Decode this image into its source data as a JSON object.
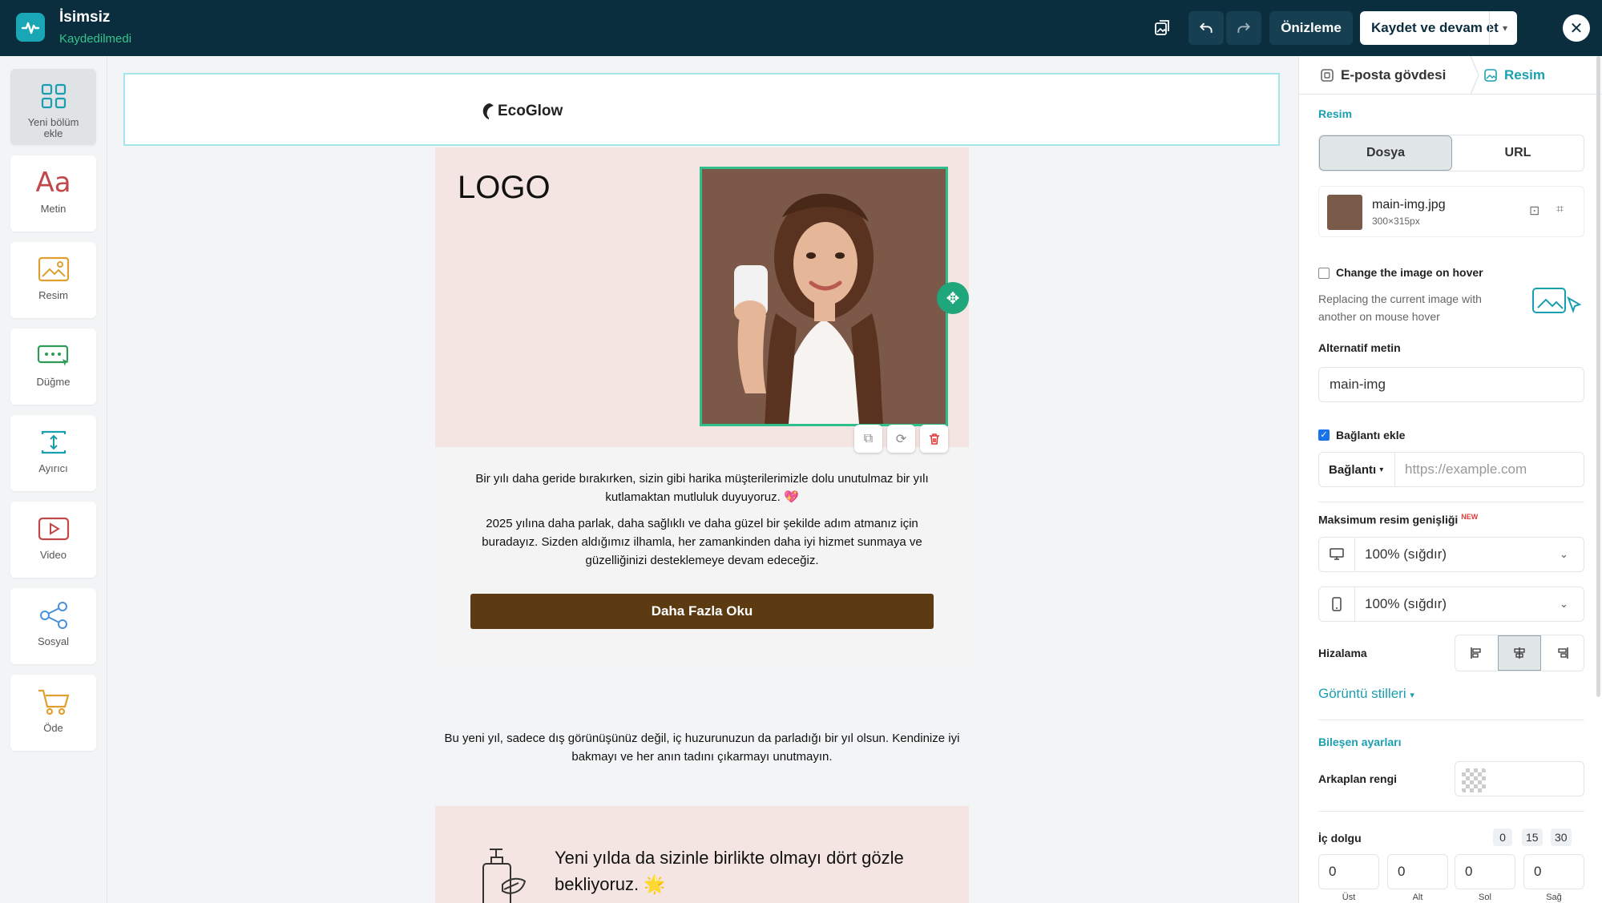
{
  "app": {
    "title": "İsimsiz",
    "status": "Kaydedilmedi",
    "preview_label": "Önizleme",
    "save_label": "Kaydet ve devam et",
    "close_glyph": "✕",
    "accent": "#19a7b5",
    "topbar_color": "#0b2e3f"
  },
  "sidebar": {
    "items": [
      {
        "label": "Yeni bölüm ekle",
        "icon": "grid-icon"
      },
      {
        "label": "Metin",
        "icon": "text-icon"
      },
      {
        "label": "Resim",
        "icon": "image-icon"
      },
      {
        "label": "Düğme",
        "icon": "button-icon"
      },
      {
        "label": "Ayırıcı",
        "icon": "divider-icon"
      },
      {
        "label": "Video",
        "icon": "video-icon"
      },
      {
        "label": "Sosyal",
        "icon": "share-icon"
      },
      {
        "label": "Öde",
        "icon": "cart-icon"
      }
    ]
  },
  "email": {
    "brand": "EcoGlow",
    "logo_placeholder": "LOGO",
    "paragraph1": "Bir yılı daha geride bırakırken, sizin gibi harika müşterilerimizle dolu unutulmaz bir yılı kutlamaktan mutluluk duyuyoruz. 💖",
    "paragraph2": "2025 yılına daha parlak, daha sağlıklı ve daha güzel bir şekilde adım atmanız için buradayız. Sizden aldığımız ilhamla, her zamankinden daha iyi hizmet sunmaya ve güzelliğinizi desteklemeye devam edeceğiz.",
    "cta_label": "Daha Fazla Oku",
    "cta_color": "#5c3b12",
    "note": "Bu yeni yıl, sadece dış görünüşünüz değil, iç huzurunuzun da parladığı bir yıl olsun. Kendinize iyi bakmayı ve her anın tadını çıkarmayı unutmayın.",
    "closing": "Yeni yılda da sizinle birlikte olmayı dört gözle bekliyoruz. 🌟"
  },
  "panel": {
    "tab_body": "E-posta gövdesi",
    "tab_image": "Resim",
    "section_image": "Resim",
    "seg_file": "Dosya",
    "seg_url": "URL",
    "file_name": "main-img.jpg",
    "file_size": "300×315px",
    "hover_label": "Change the image on hover",
    "hover_desc": "Replacing the current image with another on mouse hover",
    "alt_label": "Alternatif metin",
    "alt_value": "main-img",
    "link_label": "Bağlantı ekle",
    "link_type": "Bağlantı",
    "link_placeholder": "https://example.com",
    "max_width_label": "Maksimum resim genişliği",
    "new_badge": "NEW",
    "desktop_width": "100% (sığdır)",
    "mobile_width": "100% (sığdır)",
    "align_label": "Hizalama",
    "styles_label": "Görüntü stilleri",
    "component_settings": "Bileşen ayarları",
    "bg_label": "Arkaplan rengi",
    "padding_label": "İç dolgu",
    "padding_presets": [
      "0",
      "15",
      "30"
    ],
    "padding_values": [
      {
        "value": "0",
        "label": "Üst"
      },
      {
        "value": "0",
        "label": "Alt"
      },
      {
        "value": "0",
        "label": "Sol"
      },
      {
        "value": "0",
        "label": "Sağ"
      }
    ]
  }
}
